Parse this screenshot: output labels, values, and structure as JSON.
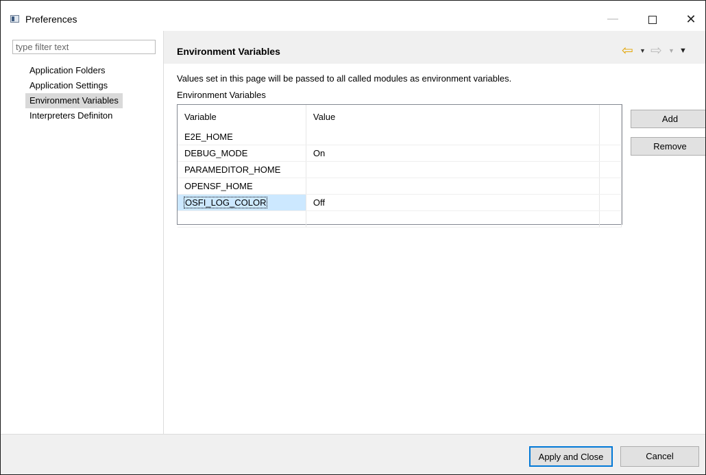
{
  "window": {
    "title": "Preferences",
    "minimize": "—",
    "close": "✕"
  },
  "sidebar": {
    "filter_placeholder": "type filter text",
    "items": [
      {
        "label": "Application Folders",
        "selected": false
      },
      {
        "label": "Application Settings",
        "selected": false
      },
      {
        "label": "Environment Variables",
        "selected": true
      },
      {
        "label": "Interpreters Definiton",
        "selected": false
      }
    ]
  },
  "page": {
    "title": "Environment Variables",
    "description": "Values set in this page will be passed to all called modules as environment variables.",
    "section_label": "Environment Variables",
    "nav": {
      "back": "⇦",
      "menu": "▼",
      "forward": "⇨"
    }
  },
  "table": {
    "columns": [
      "Variable",
      "Value"
    ],
    "rows": [
      {
        "variable": "E2E_HOME",
        "value": ""
      },
      {
        "variable": "DEBUG_MODE",
        "value": "On"
      },
      {
        "variable": "PARAMEDITOR_HOME",
        "value": ""
      },
      {
        "variable": "OPENSF_HOME",
        "value": ""
      },
      {
        "variable": "OSFI_LOG_COLOR",
        "value": "Off"
      },
      {
        "variable": "",
        "value": ""
      }
    ],
    "selected_row": 4
  },
  "buttons": {
    "add": "Add",
    "remove": "Remove",
    "apply_close": "Apply and Close",
    "cancel": "Cancel"
  },
  "colors": {
    "accent": "#0078d7",
    "selection": "#cce8ff",
    "back_arrow": "#e3a400"
  }
}
